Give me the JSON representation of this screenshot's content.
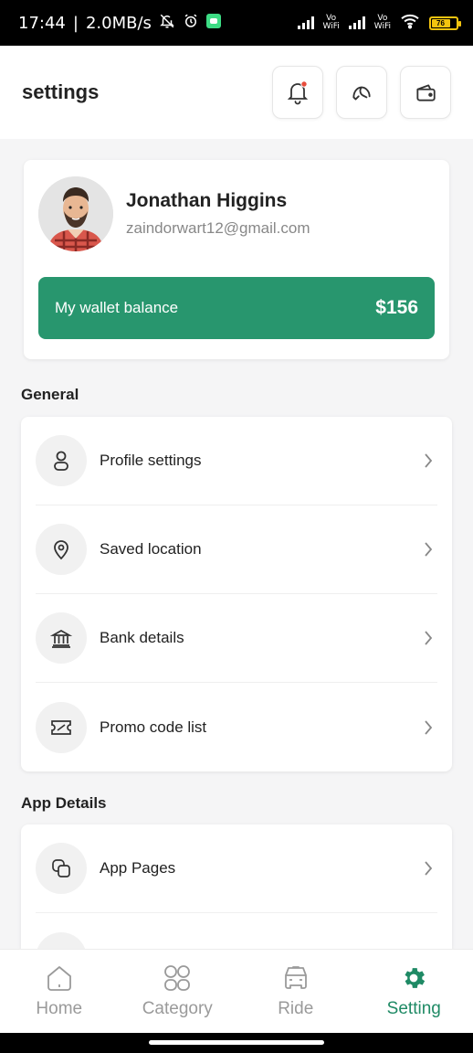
{
  "status_bar": {
    "time": "17:44",
    "speed": "2.0MB/s",
    "battery": "76",
    "vowifi_top": "Vo",
    "vowifi_bottom": "WiFi"
  },
  "header": {
    "title": "settings"
  },
  "profile": {
    "name": "Jonathan Higgins",
    "email": "zaindorwart12@gmail.com"
  },
  "wallet": {
    "label": "My wallet balance",
    "amount": "$156"
  },
  "general": {
    "title": "General",
    "items": [
      {
        "label": "Profile settings",
        "icon": "user-icon"
      },
      {
        "label": "Saved location",
        "icon": "location-pin-icon"
      },
      {
        "label": "Bank details",
        "icon": "bank-icon"
      },
      {
        "label": "Promo code list",
        "icon": "ticket-icon"
      }
    ]
  },
  "app_details": {
    "title": "App Details",
    "items": [
      {
        "label": "App Pages",
        "icon": "pages-icon"
      }
    ]
  },
  "nav": [
    {
      "label": "Home",
      "icon": "home-icon"
    },
    {
      "label": "Category",
      "icon": "category-icon"
    },
    {
      "label": "Ride",
      "icon": "car-icon"
    },
    {
      "label": "Setting",
      "icon": "gear-icon",
      "active": true
    }
  ],
  "colors": {
    "accent": "#28966e",
    "active_nav": "#1f8a65",
    "notification_dot": "#e74c3c"
  }
}
